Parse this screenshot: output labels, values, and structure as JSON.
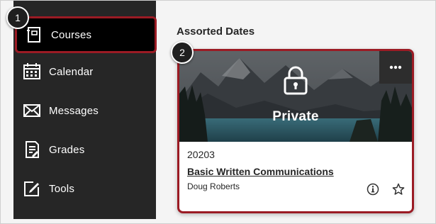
{
  "sidebar": {
    "items": [
      {
        "label": "Courses",
        "icon": "courses-icon",
        "active": true
      },
      {
        "label": "Calendar",
        "icon": "calendar-icon"
      },
      {
        "label": "Messages",
        "icon": "envelope-icon"
      },
      {
        "label": "Grades",
        "icon": "grades-icon"
      },
      {
        "label": "Tools",
        "icon": "tools-icon"
      }
    ]
  },
  "main": {
    "section_title": "Assorted Dates",
    "card": {
      "banner_label": "Private",
      "code": "20203",
      "name": "Basic Written Communications",
      "instructor": "Doug Roberts",
      "more_icon": "more-icon",
      "info_icon": "info-icon",
      "favorite_icon": "star-icon"
    }
  },
  "callouts": [
    "1",
    "2"
  ],
  "colors": {
    "accent": "#9b1b24",
    "sidebar_bg": "#262626",
    "page_bg": "#f4f4f4"
  }
}
